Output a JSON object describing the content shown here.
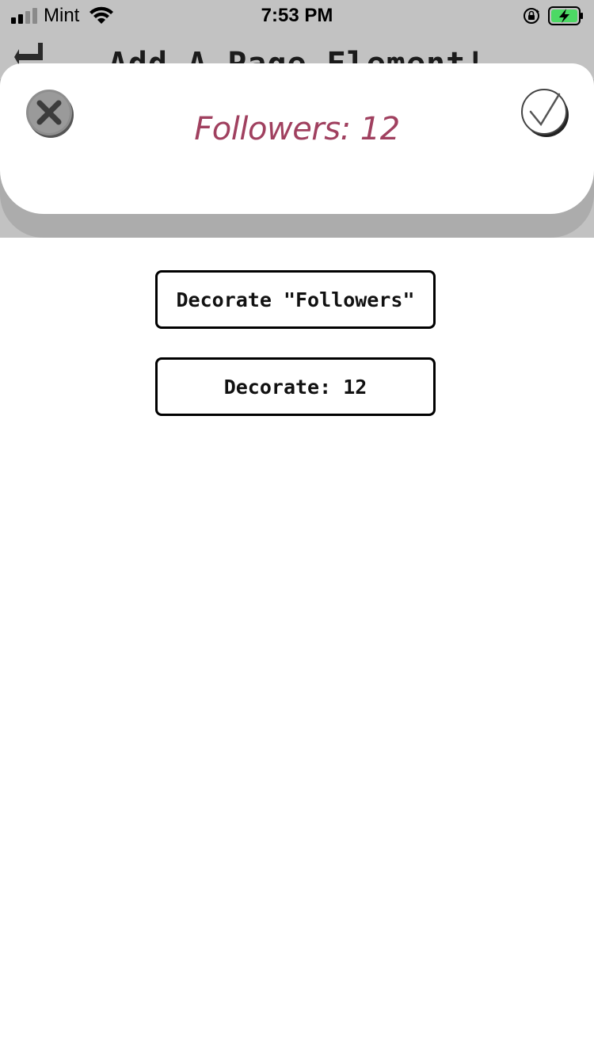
{
  "status_bar": {
    "carrier": "Mint",
    "time": "7:53 PM",
    "battery_icon": "battery-charging-icon",
    "wifi_icon": "wifi-icon",
    "signal_icon": "cellular-signal-icon",
    "rotation_lock_icon": "rotation-lock-icon",
    "battery_color": "#4cd964"
  },
  "underlay": {
    "title": "Add A Page Element!",
    "back_icon": "back-arrow-icon"
  },
  "modal": {
    "title": "Followers: 12",
    "title_color": "#a0405f",
    "close_icon": "close-circle-icon",
    "confirm_icon": "checkmark-circle-icon"
  },
  "actions": {
    "decorate_label_button": "Decorate \"Followers\"",
    "decorate_value_button": "Decorate: 12"
  }
}
